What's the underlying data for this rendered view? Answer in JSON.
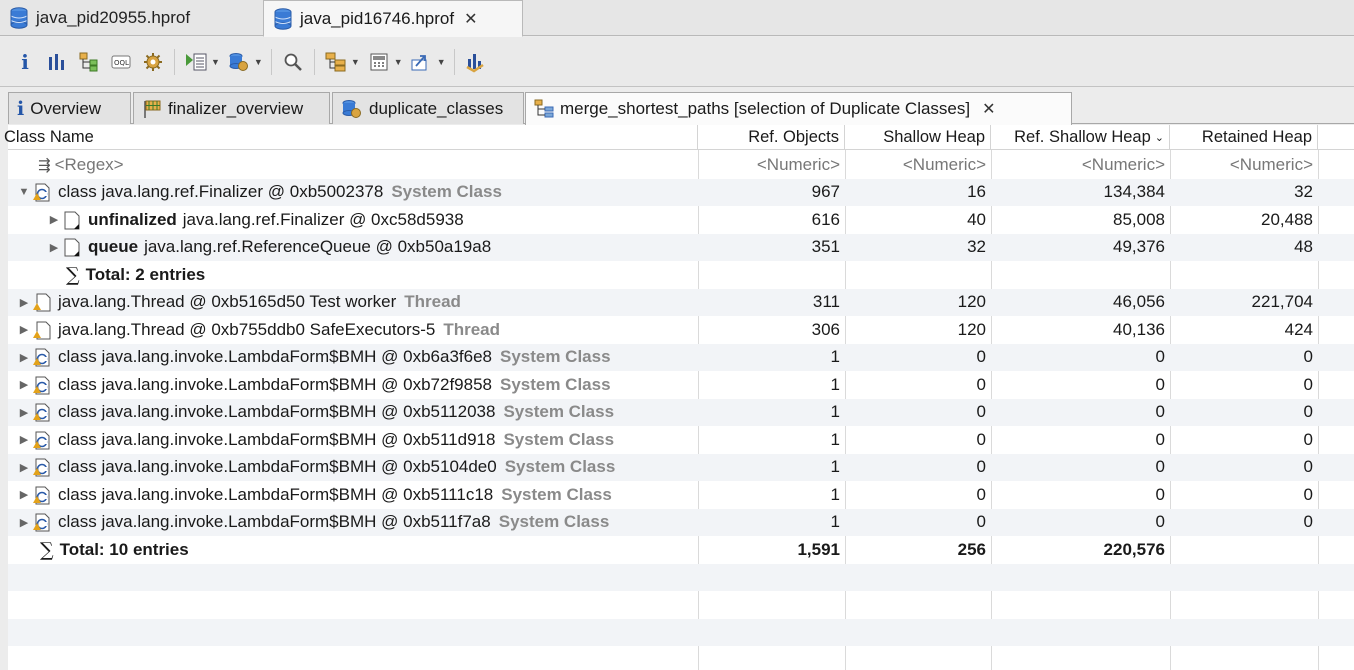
{
  "editor_tabs": [
    {
      "label": "java_pid20955.hprof",
      "active": false
    },
    {
      "label": "java_pid16746.hprof",
      "active": true
    }
  ],
  "inner_tabs": [
    {
      "label": "Overview"
    },
    {
      "label": "finalizer_overview"
    },
    {
      "label": "duplicate_classes"
    },
    {
      "label": "merge_shortest_paths [selection of Duplicate Classes]",
      "active": true
    }
  ],
  "columns": {
    "name": "Class Name",
    "ref_objects": "Ref. Objects",
    "shallow_heap": "Shallow Heap",
    "ref_shallow_heap": "Ref. Shallow Heap",
    "retained_heap": "Retained Heap"
  },
  "filter_row": {
    "name": "<Regex>",
    "ref_objects": "<Numeric>",
    "shallow_heap": "<Numeric>",
    "ref_shallow_heap": "<Numeric>",
    "retained_heap": "<Numeric>"
  },
  "rows": [
    {
      "kind": "class",
      "expander": "▼",
      "indent": 0,
      "label": "class java.lang.ref.Finalizer @ 0xb5002378",
      "tag": "System Class",
      "ref_objects": "967",
      "shallow_heap": "16",
      "ref_shallow_heap": "134,384",
      "retained_heap": "32"
    },
    {
      "kind": "object",
      "expander": "▶",
      "indent": 1,
      "field": "unfinalized",
      "label": "java.lang.ref.Finalizer @ 0xc58d5938",
      "tag": "",
      "ref_objects": "616",
      "shallow_heap": "40",
      "ref_shallow_heap": "85,008",
      "retained_heap": "20,488"
    },
    {
      "kind": "object",
      "expander": "▶",
      "indent": 1,
      "field": "queue",
      "label": "java.lang.ref.ReferenceQueue @ 0xb50a19a8",
      "tag": "",
      "ref_objects": "351",
      "shallow_heap": "32",
      "ref_shallow_heap": "49,376",
      "retained_heap": "48"
    },
    {
      "kind": "total",
      "indent": 1,
      "label": "Total: 2 entries",
      "ref_objects": "",
      "shallow_heap": "",
      "ref_shallow_heap": "",
      "retained_heap": ""
    },
    {
      "kind": "object",
      "expander": "▶",
      "indent": 0,
      "label": "java.lang.Thread @ 0xb5165d50  Test worker",
      "tag": "Thread",
      "ref_objects": "311",
      "shallow_heap": "120",
      "ref_shallow_heap": "46,056",
      "retained_heap": "221,704"
    },
    {
      "kind": "object",
      "expander": "▶",
      "indent": 0,
      "label": "java.lang.Thread @ 0xb755ddb0  SafeExecutors-5",
      "tag": "Thread",
      "ref_objects": "306",
      "shallow_heap": "120",
      "ref_shallow_heap": "40,136",
      "retained_heap": "424"
    },
    {
      "kind": "class",
      "expander": "▶",
      "indent": 0,
      "label": "class java.lang.invoke.LambdaForm$BMH @ 0xb6a3f6e8",
      "tag": "System Class",
      "ref_objects": "1",
      "shallow_heap": "0",
      "ref_shallow_heap": "0",
      "retained_heap": "0"
    },
    {
      "kind": "class",
      "expander": "▶",
      "indent": 0,
      "label": "class java.lang.invoke.LambdaForm$BMH @ 0xb72f9858",
      "tag": "System Class",
      "ref_objects": "1",
      "shallow_heap": "0",
      "ref_shallow_heap": "0",
      "retained_heap": "0"
    },
    {
      "kind": "class",
      "expander": "▶",
      "indent": 0,
      "label": "class java.lang.invoke.LambdaForm$BMH @ 0xb5112038",
      "tag": "System Class",
      "ref_objects": "1",
      "shallow_heap": "0",
      "ref_shallow_heap": "0",
      "retained_heap": "0"
    },
    {
      "kind": "class",
      "expander": "▶",
      "indent": 0,
      "label": "class java.lang.invoke.LambdaForm$BMH @ 0xb511d918",
      "tag": "System Class",
      "ref_objects": "1",
      "shallow_heap": "0",
      "ref_shallow_heap": "0",
      "retained_heap": "0"
    },
    {
      "kind": "class",
      "expander": "▶",
      "indent": 0,
      "label": "class java.lang.invoke.LambdaForm$BMH @ 0xb5104de0",
      "tag": "System Class",
      "ref_objects": "1",
      "shallow_heap": "0",
      "ref_shallow_heap": "0",
      "retained_heap": "0"
    },
    {
      "kind": "class",
      "expander": "▶",
      "indent": 0,
      "label": "class java.lang.invoke.LambdaForm$BMH @ 0xb5111c18",
      "tag": "System Class",
      "ref_objects": "1",
      "shallow_heap": "0",
      "ref_shallow_heap": "0",
      "retained_heap": "0"
    },
    {
      "kind": "class",
      "expander": "▶",
      "indent": 0,
      "label": "class java.lang.invoke.LambdaForm$BMH @ 0xb511f7a8",
      "tag": "System Class",
      "ref_objects": "1",
      "shallow_heap": "0",
      "ref_shallow_heap": "0",
      "retained_heap": "0"
    },
    {
      "kind": "total",
      "indent": 0,
      "label": "Total: 10 entries",
      "ref_objects": "1,591",
      "shallow_heap": "256",
      "ref_shallow_heap": "220,576",
      "retained_heap": ""
    }
  ],
  "sort_indicator": "⌄",
  "close_glyph": "✕",
  "filter_glyph": "⇶",
  "sigma_glyph": "∑",
  "info_glyph": "i",
  "accent_colors": {
    "db_icon": "#3a7bd5",
    "class_icon": "#e3a21a",
    "selected_tab": "#fbfbfb"
  }
}
